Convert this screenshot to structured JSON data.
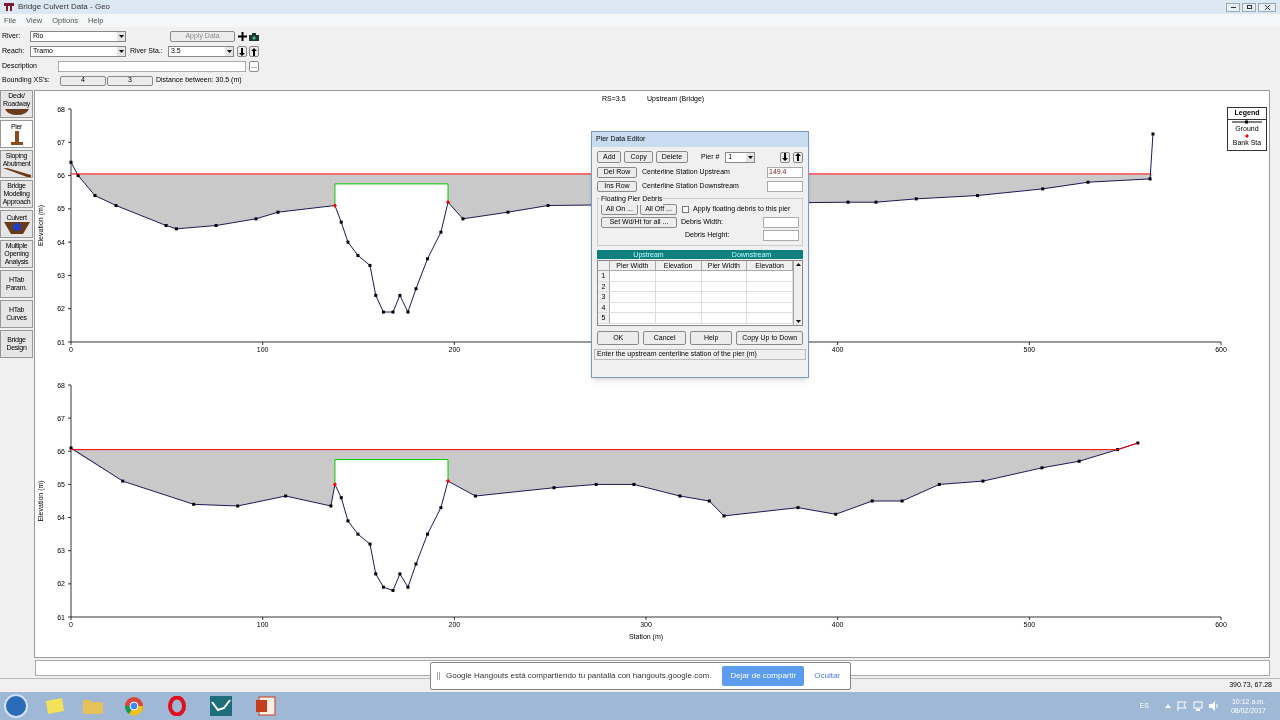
{
  "window": {
    "title": "Bridge Culvert Data - Geo"
  },
  "menu": [
    "File",
    "View",
    "Options",
    "Help"
  ],
  "form": {
    "river_label": "River:",
    "river": "Rio",
    "apply_button": {
      "label": "Apply Data",
      "disabled": true
    },
    "reach_label": "Reach:",
    "reach": "Tramo",
    "river_sta_label": "River Sta.:",
    "river_sta": "3.5",
    "description_label": "Description",
    "more_button": "...",
    "bounding_label": "Bounding XS's:",
    "bounding": [
      "4",
      "3"
    ],
    "distance": "Distance between: 30.5 (m)"
  },
  "sidebar": [
    {
      "label": "Deck/ Roadway",
      "kind": "deck",
      "selected": false
    },
    {
      "label": "Pier",
      "kind": "pier",
      "selected": true
    },
    {
      "label": "Sloping Abutment",
      "kind": "abutment",
      "selected": false
    },
    {
      "label": "Bridge Modeling Approach",
      "kind": "text",
      "selected": false
    },
    {
      "label": "Culvert",
      "kind": "culvert",
      "selected": false
    },
    {
      "label": "Multiple Opening Analysis",
      "kind": "text",
      "selected": false
    },
    {
      "label": "HTab Param.",
      "kind": "text",
      "selected": false
    },
    {
      "label": "HTab Curves",
      "kind": "text",
      "selected": false
    },
    {
      "label": "Bridge Design",
      "kind": "text",
      "selected": false
    }
  ],
  "charts": [
    {
      "header": [
        "RS=3.5",
        "Upstream  (Bridge)"
      ],
      "chart_data": {
        "type": "line",
        "ylabel": "Elevation (m)",
        "xlim": [
          0,
          600
        ],
        "ylim": [
          61,
          68
        ],
        "xticks": [
          0,
          100,
          200,
          400,
          500,
          600
        ],
        "yticks": [
          61,
          62,
          63,
          64,
          65,
          66,
          67,
          68
        ],
        "series": [
          {
            "name": "Ground",
            "color": "#000000",
            "marker": "square",
            "x": [
              0,
              3.7,
              12.5,
              23.5,
              49.6,
              55,
              75.7,
              96.5,
              108,
              137.7,
              141,
              144.5,
              149.7,
              156,
              159,
              163,
              168,
              171.6,
              175.8,
              180,
              186,
              193,
              196.7,
              204.5,
              228,
              248.9,
              405.4,
              420,
              441,
              473,
              507,
              530.6,
              563,
              564.5
            ],
            "values": [
              66.4,
              66,
              65.4,
              65.1,
              64.5,
              64.4,
              64.5,
              64.7,
              64.9,
              65.1,
              64.6,
              64,
              63.6,
              63.3,
              62.4,
              61.9,
              61.9,
              62.4,
              61.9,
              62.6,
              63.5,
              64.3,
              65.2,
              64.7,
              64.9,
              65.1,
              65.2,
              65.2,
              65.3,
              65.4,
              65.6,
              65.8,
              65.9,
              67.25
            ]
          },
          {
            "color": "#ff0000",
            "x": [
              0,
              563
            ],
            "values": [
              66.05,
              66.05
            ]
          },
          {
            "color": "#00cc00",
            "x": [
              137.7,
              137.7,
              196.7,
              196.7
            ],
            "values": [
              65.1,
              65.75,
              65.75,
              65.2
            ]
          },
          {
            "name": "Bank Sta",
            "type": "scatter",
            "marker": "diamond",
            "color": "#ff0000",
            "x": [
              137.7,
              196.7
            ],
            "values": [
              65.1,
              65.2
            ]
          }
        ]
      }
    },
    {
      "chart_data": {
        "type": "line",
        "xlabel": "Station (m)",
        "ylabel": "Elevation (m)",
        "xlim": [
          0,
          600
        ],
        "ylim": [
          61,
          68
        ],
        "xticks": [
          0,
          100,
          200,
          300,
          400,
          500,
          600
        ],
        "yticks": [
          61,
          62,
          63,
          64,
          65,
          66,
          67,
          68
        ],
        "series": [
          {
            "color": "#000000",
            "marker": "square",
            "x": [
              0,
              27,
              64,
              87,
              112,
              135.6,
              137.7,
              141,
              144.5,
              149.7,
              156,
              159,
              163,
              168,
              171.6,
              175.8,
              180,
              186,
              193,
              196.7,
              211,
              252,
              274,
              293.7,
              317.7,
              333,
              340.7,
              379.3,
              399,
              418,
              433.6,
              453,
              475.8,
              506.6,
              526,
              546,
              556.6
            ],
            "values": [
              66.1,
              65.1,
              64.4,
              64.35,
              64.65,
              64.35,
              65,
              64.6,
              63.9,
              63.5,
              63.2,
              62.3,
              61.9,
              61.8,
              62.3,
              61.9,
              62.6,
              63.5,
              64.3,
              65.1,
              64.65,
              64.9,
              65,
              65,
              64.65,
              64.5,
              64.05,
              64.3,
              64.1,
              64.5,
              64.5,
              65,
              65.1,
              65.5,
              65.7,
              66.05,
              66.25
            ]
          },
          {
            "color": "#ff0000",
            "x": [
              0,
              546,
              556.6
            ],
            "values": [
              66.05,
              66.05,
              66.25
            ]
          },
          {
            "color": "#00cc00",
            "x": [
              137.7,
              137.7,
              196.7,
              196.7
            ],
            "values": [
              65,
              65.75,
              65.75,
              65.1
            ]
          },
          {
            "type": "scatter",
            "marker": "diamond",
            "color": "#ff0000",
            "x": [
              137.7,
              196.7
            ],
            "values": [
              65,
              65.1
            ]
          }
        ]
      }
    }
  ],
  "legend": {
    "title": "Legend"
  },
  "pier_editor": {
    "title": "Pier Data Editor",
    "buttons": [
      "Add",
      "Copy",
      "Delete"
    ],
    "pier_label": "Pier #",
    "pier": "1",
    "del_row": "Del Row",
    "ins_row": "Ins Row",
    "upstream_label": "Centerline Station Upstream",
    "upstream": "149.4",
    "downstream_label": "Centerline Station Downstream",
    "debris_group": "Floating Pier Debris",
    "all_on": "All On ...",
    "all_off": "All Off ...",
    "set_all": "Set Wd/Ht for all ...",
    "apply_debris": {
      "label": "Apply floating debris to this pier",
      "checked": false
    },
    "debris_width_label": "Debris Width:",
    "debris_height_label": "Debris Height:",
    "table_groups": [
      "Upstream",
      "Downstream"
    ],
    "columns": [
      "Pier Width",
      "Elevation",
      "Pier Width",
      "Elevation"
    ],
    "rows": [
      "1",
      "2",
      "3",
      "4",
      "5"
    ],
    "footer_buttons": [
      "OK",
      "Cancel",
      "Help",
      "Copy Up to Down"
    ],
    "status": "Enter the upstream centerline station of the pier (m)"
  },
  "coordinates": "390.73, 67.28",
  "notification": {
    "message": "Google Hangouts está compartiendo tu pantalla con hangouts.google.com.",
    "stop_button": "Dejar de compartir",
    "hide_link": "Ocultar"
  },
  "taskbar": {
    "language": "ES",
    "time": "10:12 a.m.",
    "date": "08/02/2017"
  }
}
